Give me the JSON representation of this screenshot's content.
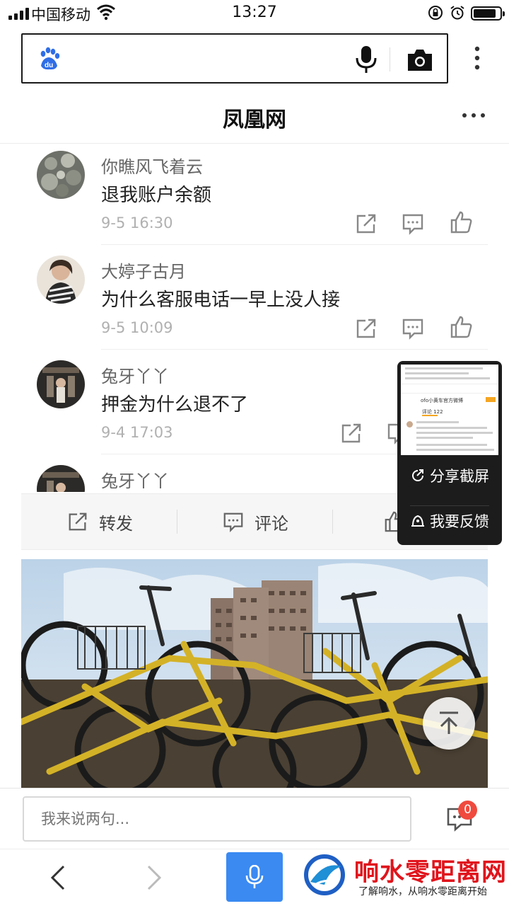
{
  "status_bar": {
    "carrier": "中国移动",
    "time": "13:27",
    "battery_level": 0.85
  },
  "search": {
    "placeholder": ""
  },
  "header": {
    "title": "凤凰网"
  },
  "comments": [
    {
      "name": "你瞧风飞着云",
      "text": "退我账户余额",
      "time": "9-5 16:30"
    },
    {
      "name": "大婷子古月",
      "text": "为什么客服电话一早上没人接",
      "time": "9-5 10:09"
    },
    {
      "name": "兔牙丫丫",
      "text": "押金为什么退不了",
      "time": "9-4 17:03"
    },
    {
      "name": "兔牙丫丫",
      "text": "",
      "time": ""
    }
  ],
  "action_bar": {
    "forward_label": "转发",
    "comment_label": "评论"
  },
  "float_panel": {
    "share_label": "分享截屏",
    "feedback_label": "我要反馈",
    "thumbnail": {
      "tab_label": "评论 122",
      "header_text": "ofo小黄车官方微博"
    }
  },
  "comment_bar": {
    "placeholder": "我来说两句...",
    "badge_count": "0"
  },
  "watermark": {
    "title": "响水零距离网",
    "slogan": "了解响水，从响水零距离开始"
  },
  "colors": {
    "accent_blue": "#3a8af2",
    "badge_red": "#f04a3e",
    "watermark_red": "#e0141c"
  }
}
